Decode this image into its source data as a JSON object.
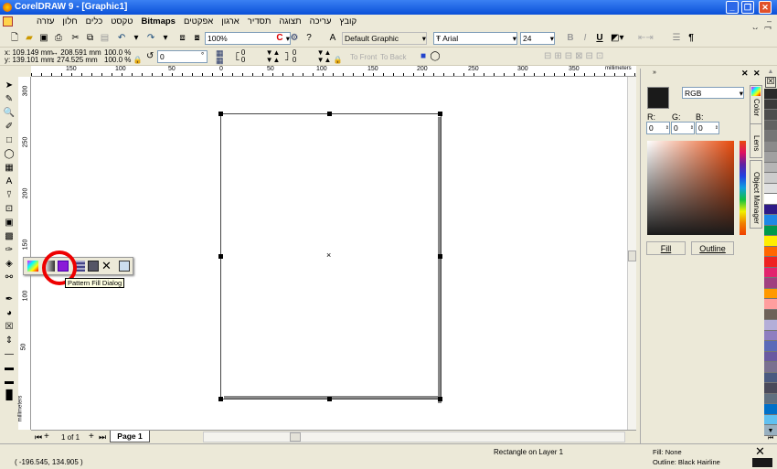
{
  "window": {
    "title": "CorelDRAW 9 - [Graphic1]"
  },
  "menu": [
    "קובץ",
    "עריכה",
    "תצוגה",
    "תסדיר",
    "ארגון",
    "אפקטים",
    "Bitmaps",
    "טקסט",
    "כלים",
    "חלון",
    "עזרה"
  ],
  "toolbar": {
    "zoom": "100%",
    "style": "Default Graphic",
    "font": "Arial",
    "font_size": "24",
    "bold": "B",
    "italic": "I",
    "underline": "U",
    "para": "¶"
  },
  "property_bar": {
    "x": "x: 109.149 mm",
    "y": "y: 139.101 mm",
    "width": "208.591 mm",
    "height": "274.525 mm",
    "scale_x": "100.0",
    "scale_y": "100.0",
    "pct": "%",
    "rotation": "0",
    "deg": "°",
    "corner_tl": "0",
    "corner_bl": "0",
    "corner_tr": "0",
    "corner_br": "0",
    "to_front": "To Front",
    "to_back": "To Back"
  },
  "ruler": {
    "h_ticks": [
      "150",
      "100",
      "50",
      "0",
      "50",
      "100",
      "150",
      "200",
      "250",
      "300",
      "350"
    ],
    "unit": "millimeters",
    "v_ticks": [
      "300",
      "250",
      "200",
      "150",
      "100",
      "50"
    ],
    "v_unit": "millimeters"
  },
  "flyout": {
    "tooltip": "Pattern Fill Dialog"
  },
  "docker": {
    "color_model": "RGB",
    "r_label": "R:",
    "g_label": "G:",
    "b_label": "B:",
    "r": "0",
    "g": "0",
    "b": "0",
    "fill_button": "Fill",
    "outline_button": "Outline",
    "tabs": [
      "Color",
      "Lens",
      "Object Manager"
    ],
    "swatch_color": "#1a1a1a"
  },
  "palette": [
    "#2a2a2a",
    "#3a3a3a",
    "#4d4d4d",
    "#616161",
    "#757575",
    "#8a8a8a",
    "#a0a0a0",
    "#b5b5b5",
    "#cccccc",
    "#e0e0e0",
    "#ffffff",
    "#2e1a87",
    "#1e88e5",
    "#00994d",
    "#ffee00",
    "#ff6600",
    "#ee2222",
    "#e2246e",
    "#a04080",
    "#ff9900",
    "#ff9e9e",
    "#6e6258",
    "#b4aed8",
    "#8e7ec0",
    "#5a6ab8",
    "#6a5aa0",
    "#7a7090",
    "#4a5a80",
    "#4a4a5a",
    "#607080",
    "#0070c8",
    "#60c0f0",
    "#98b0c0"
  ],
  "page_nav": {
    "counter": "1 of 1",
    "tab": "Page 1"
  },
  "status": {
    "coords": "( -196.545, 134.905 )",
    "object": "Rectangle on Layer 1",
    "fill": "Fill: None",
    "outline": "Outline: Black  Hairline"
  }
}
